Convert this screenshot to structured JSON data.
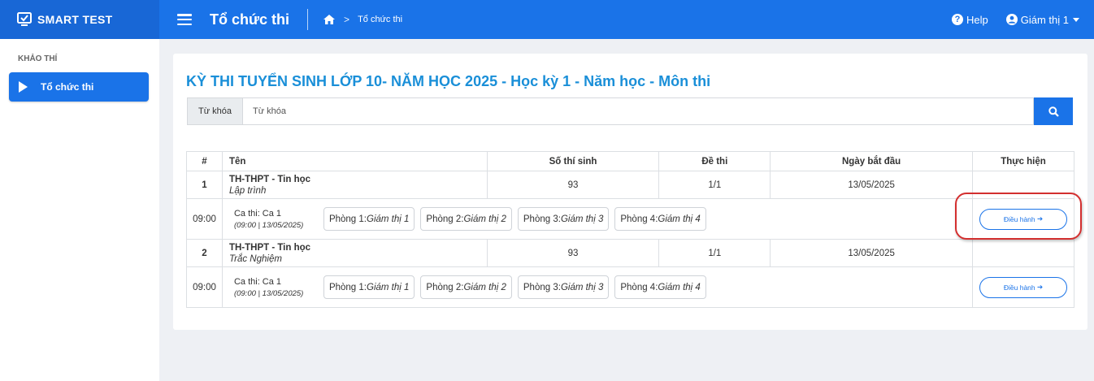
{
  "app": {
    "brand": "SMART TEST",
    "page_title": "Tổ chức thi"
  },
  "breadcrumb": {
    "current": "Tổ chức thi"
  },
  "topbar": {
    "help": "Help",
    "user": "Giám thị 1"
  },
  "sidebar": {
    "section": "KHẢO THÍ",
    "items": [
      {
        "label": "Tổ chức thi"
      }
    ]
  },
  "main": {
    "title": "KỲ THI TUYỂN SINH LỚP 10- NĂM HỌC 2025 - Học kỳ 1 - Năm học - Môn thi",
    "search": {
      "label": "Từ khóa",
      "placeholder": "Từ khóa"
    },
    "table": {
      "headers": [
        "#",
        "Tên",
        "Số thí sinh",
        "Đề thi",
        "Ngày bắt đầu",
        "Thực hiện"
      ],
      "rows": [
        {
          "index": "1",
          "name": "TH-THPT - Tin học",
          "type": "Lập trình",
          "candidates": "93",
          "exam": "1/1",
          "start_date": "13/05/2025",
          "session": {
            "time": "09:00",
            "label": "Ca thi: Ca 1",
            "detail": "(09:00 | 13/05/2025)",
            "action": "Điều hành",
            "rooms": [
              {
                "room": "Phòng 1:",
                "proctor": "Giám thị 1"
              },
              {
                "room": "Phòng 2:",
                "proctor": "Giám thị 2"
              },
              {
                "room": "Phòng 3:",
                "proctor": "Giám thị 3"
              },
              {
                "room": "Phòng 4:",
                "proctor": "Giám thị 4"
              }
            ]
          }
        },
        {
          "index": "2",
          "name": "TH-THPT - Tin học",
          "type": "Trắc Nghiệm",
          "candidates": "93",
          "exam": "1/1",
          "start_date": "13/05/2025",
          "session": {
            "time": "09:00",
            "label": "Ca thi: Ca 1",
            "detail": "(09:00 | 13/05/2025)",
            "action": "Điều hành",
            "rooms": [
              {
                "room": "Phòng 1:",
                "proctor": "Giám thị 1"
              },
              {
                "room": "Phòng 2:",
                "proctor": "Giám thị 2"
              },
              {
                "room": "Phòng 3:",
                "proctor": "Giám thị 3"
              },
              {
                "room": "Phòng 4:",
                "proctor": "Giám thị 4"
              }
            ]
          }
        }
      ]
    }
  },
  "colors": {
    "primary": "#1a73e8",
    "title": "#1a8fd8",
    "exam_link": "#2e8b3a",
    "highlight": "#d32f2f"
  },
  "icons": [
    "logo-icon",
    "menu-icon",
    "home-icon",
    "help-icon",
    "user-icon",
    "play-icon",
    "search-icon",
    "arrow-right-icon"
  ]
}
